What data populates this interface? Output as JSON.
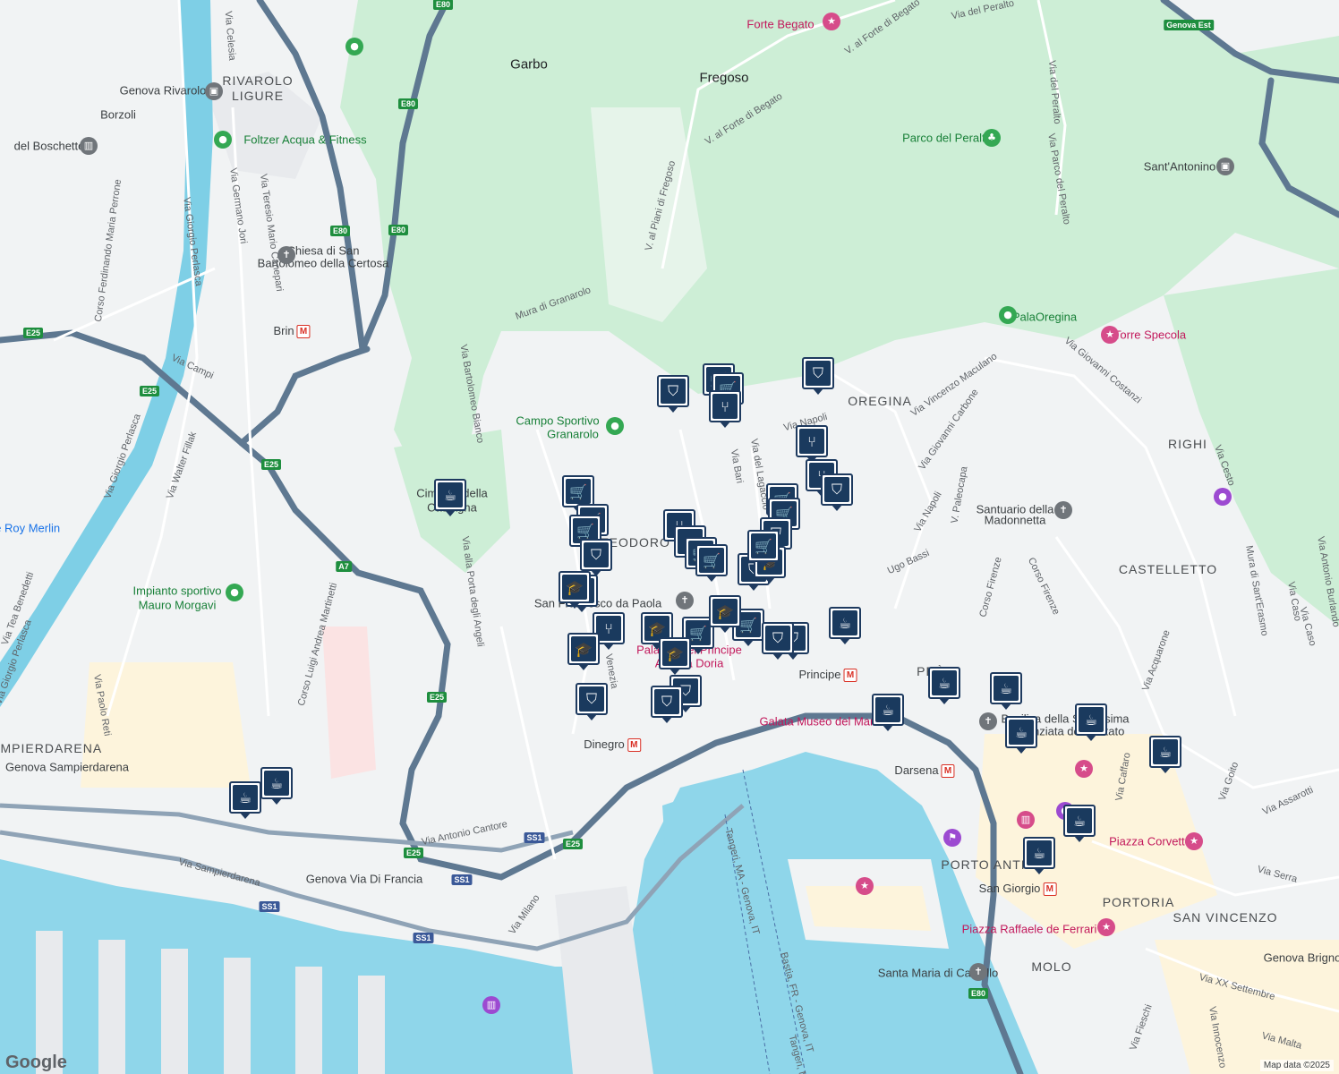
{
  "area_labels": [
    {
      "text": "Garbo",
      "type": "place"
    },
    {
      "text": "Fregoso",
      "type": "place"
    },
    {
      "text": "RIVAROLO",
      "type": "area"
    },
    {
      "text": "LIGURE",
      "type": "area"
    },
    {
      "text": "OREGINA",
      "type": "area"
    },
    {
      "text": "RIGHI",
      "type": "area"
    },
    {
      "text": "CASTELLETTO",
      "type": "area"
    },
    {
      "text": "SAMPIERDARENA",
      "type": "area"
    },
    {
      "text": "TEODORO",
      "type": "area"
    },
    {
      "text": "PRÈ",
      "type": "area"
    },
    {
      "text": "PORTORIA",
      "type": "area"
    },
    {
      "text": "SAN VINCENZO",
      "type": "area"
    },
    {
      "text": "MOLO",
      "type": "area"
    },
    {
      "text": "PORTO ANTICO",
      "type": "area"
    }
  ],
  "poi_labels": [
    {
      "text": "Forte Begato",
      "color": "pink"
    },
    {
      "text": "Foltzer Acqua & Fitness",
      "color": "green"
    },
    {
      "text": "Parco del Peralto",
      "color": "green"
    },
    {
      "text": "Sant'Antonino",
      "color": "gray"
    },
    {
      "text": "Chiesa di San",
      "color": "gray"
    },
    {
      "text": "Bartolomeo della Certosa",
      "color": "gray"
    },
    {
      "text": "del Boschetto",
      "color": "gray"
    },
    {
      "text": "Genova Rivarolo",
      "color": "gray"
    },
    {
      "text": "Borzoli",
      "color": "gray"
    },
    {
      "text": "Brin",
      "color": "gray",
      "metro": true
    },
    {
      "text": "PalaOregina",
      "color": "green"
    },
    {
      "text": "Torre Specola",
      "color": "pink"
    },
    {
      "text": "Campo Sportivo",
      "color": "green"
    },
    {
      "text": "Granarolo",
      "color": "green"
    },
    {
      "text": "Cimitero della",
      "color": "gray"
    },
    {
      "text": "Castagna",
      "color": "gray"
    },
    {
      "text": "Impianto sportivo",
      "color": "green"
    },
    {
      "text": "Mauro Morgavi",
      "color": "green"
    },
    {
      "text": "Santuario della",
      "color": "gray"
    },
    {
      "text": "Madonnetta",
      "color": "gray"
    },
    {
      "text": "San Francesco da Paola",
      "color": "gray"
    },
    {
      "text": "Palazzo del Principe",
      "color": "pink"
    },
    {
      "text": "Andrea Doria",
      "color": "pink"
    },
    {
      "text": "Principe",
      "color": "gray",
      "metro": true
    },
    {
      "text": "Galata Museo del Mare",
      "color": "pink"
    },
    {
      "text": "Dinegro",
      "color": "gray",
      "metro": true
    },
    {
      "text": "Darsena",
      "color": "gray",
      "metro": true
    },
    {
      "text": "Genova Sampierdarena",
      "color": "gray"
    },
    {
      "text": "Genova Via Di Francia",
      "color": "gray"
    },
    {
      "text": "Basilica della Santissima",
      "color": "gray"
    },
    {
      "text": "Annunziata del Vastato",
      "color": "gray"
    },
    {
      "text": "Piazza Corvetto",
      "color": "pink"
    },
    {
      "text": "San Giorgio",
      "color": "gray",
      "metro": true
    },
    {
      "text": "Piazza Raffaele de Ferrari",
      "color": "pink"
    },
    {
      "text": "Santa Maria di Castello",
      "color": "gray"
    },
    {
      "text": "Genova Brignole",
      "color": "gray"
    },
    {
      "text": "Le Roy Merlin",
      "color": "blue"
    }
  ],
  "street_labels": [
    "Via del Peralto",
    "V. al Forte di Begato",
    "V. al Forte di Begato",
    "V. al Piani di Fregoso",
    "Via del Peralto",
    "Via Parco del Peralto",
    "Via Teresio Mario Canepari",
    "Via Germano Jori",
    "Via Giorgio Perlasca",
    "Corso Ferdinando Maria Perrone",
    "Via Celesia",
    "Via Campi",
    "Via Walter Fillak",
    "Via Giorgio Perlasca",
    "Mura di Granarolo",
    "Via Bartolomeo Bianco",
    "Via alla Porta degli Angeli",
    "Corso Luigi Andrea Martinetti",
    "Via Paolo Reti",
    "Via Tea Benedetti",
    "Via Giorgio Perlasca",
    "Via Bari",
    "Via del Lagaccio",
    "Via Napoli",
    "Via Vincenzo Maculano",
    "Via Giovanni Carbone",
    "Via Giovanni Costanzi",
    "Via Cesto",
    "Via Napoli",
    "V. Paleocapa",
    "Ugo Bassi",
    "Corso Firenze",
    "Corso Firenze",
    "Mura di Sant'Erasmo",
    "Via Caso",
    "Via Caso",
    "Via Antonio Burlando",
    "Via Acquarone",
    "Via Caffaro",
    "Via Goito",
    "Via Assarotti",
    "Via Serra",
    "Via XX Settembre",
    "Via Malta",
    "Via Fieschi",
    "Via Innocenzo",
    "Via Antonio Cantore",
    "Via Sampierdarena",
    "Via Milano",
    "Tangeri, MA - Genova, IT",
    "Bastia, FR - Genova, IT",
    "Tangeri, MA",
    "Venezia"
  ],
  "shields": [
    "E80",
    "E80",
    "E80",
    "E80",
    "E25",
    "E25",
    "E25",
    "A7",
    "E25",
    "E25",
    "E25",
    "SS1",
    "SS1",
    "SS1",
    "SS1",
    "E80",
    "Genova Est"
  ],
  "markers": [
    {
      "icon": "bag-icon"
    },
    {
      "icon": "cart-icon"
    },
    {
      "icon": "cart-icon"
    },
    {
      "icon": "fork-knife-icon"
    },
    {
      "icon": "bag-icon"
    },
    {
      "icon": "fork-knife-icon"
    },
    {
      "icon": "fork-knife-icon"
    },
    {
      "icon": "bag-icon"
    },
    {
      "icon": "cup-icon"
    },
    {
      "icon": "cart-icon"
    },
    {
      "icon": "cart-icon"
    },
    {
      "icon": "cart-icon"
    },
    {
      "icon": "bag-icon"
    },
    {
      "icon": "fork-knife-icon"
    },
    {
      "icon": "fork-knife-icon"
    },
    {
      "icon": "cart-icon"
    },
    {
      "icon": "cart-icon"
    },
    {
      "icon": "cart-icon"
    },
    {
      "icon": "cart-icon"
    },
    {
      "icon": "bag-icon"
    },
    {
      "icon": "cap-icon"
    },
    {
      "icon": "cap-icon"
    },
    {
      "icon": "bag-icon"
    },
    {
      "icon": "cap-icon"
    },
    {
      "icon": "cart-icon"
    },
    {
      "icon": "fork-knife-icon"
    },
    {
      "icon": "cap-icon"
    },
    {
      "icon": "cap-icon"
    },
    {
      "icon": "cart-icon"
    },
    {
      "icon": "bag-icon"
    },
    {
      "icon": "bag-icon"
    },
    {
      "icon": "cup-icon"
    },
    {
      "icon": "cap-icon"
    },
    {
      "icon": "bag-icon"
    },
    {
      "icon": "bag-icon"
    },
    {
      "icon": "bag-icon"
    },
    {
      "icon": "cup-icon"
    },
    {
      "icon": "cup-icon"
    },
    {
      "icon": "cup-icon"
    },
    {
      "icon": "cup-icon"
    },
    {
      "icon": "cup-icon"
    },
    {
      "icon": "cup-icon"
    },
    {
      "icon": "cup-icon"
    },
    {
      "icon": "cup-icon"
    },
    {
      "icon": "cup-icon"
    },
    {
      "icon": "cup-icon"
    },
    {
      "icon": "cap-icon"
    },
    {
      "icon": "cart-icon"
    }
  ],
  "logo": "Google",
  "attribution": "Map data ©2025"
}
